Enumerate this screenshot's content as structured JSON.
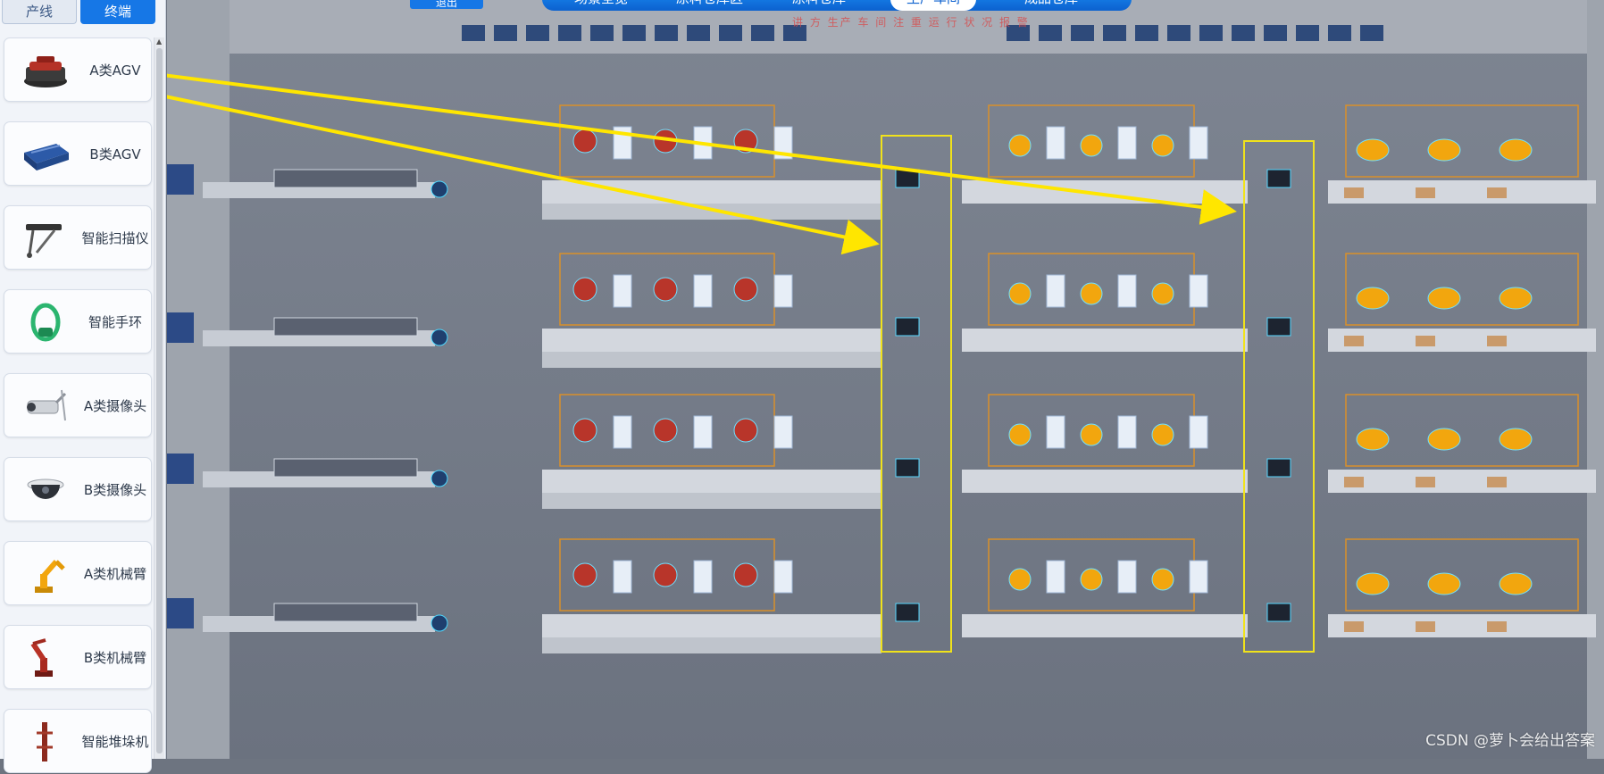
{
  "tabs": {
    "production_line": "产线",
    "terminal": "终端"
  },
  "devices": [
    {
      "label": "A类AGV",
      "icon": "agv-red-icon"
    },
    {
      "label": "B类AGV",
      "icon": "agv-blue-icon"
    },
    {
      "label": "智能扫描仪",
      "icon": "scanner-icon"
    },
    {
      "label": "智能手环",
      "icon": "wristband-icon"
    },
    {
      "label": "A类摄像头",
      "icon": "camera-bullet-icon"
    },
    {
      "label": "B类摄像头",
      "icon": "camera-dome-icon"
    },
    {
      "label": "A类机械臂",
      "icon": "robot-arm-yellow-icon"
    },
    {
      "label": "B类机械臂",
      "icon": "robot-arm-red-icon"
    },
    {
      "label": "智能堆垛机",
      "icon": "stacker-icon"
    }
  ],
  "topbar": {
    "button_label": "退出",
    "nav": [
      "场景全览",
      "原料仓库区",
      "原料仓库",
      "生产车间",
      "成品仓库"
    ],
    "active_index": 3,
    "subtext": "讲 方 生产 车 间 注 重 运 行 状 况 报 警"
  },
  "watermark": "CSDN @萝卜会给出答案",
  "colors": {
    "accent": "#1677e6",
    "highlight_box": "#f0e21b",
    "arrow": "#ffe600"
  }
}
